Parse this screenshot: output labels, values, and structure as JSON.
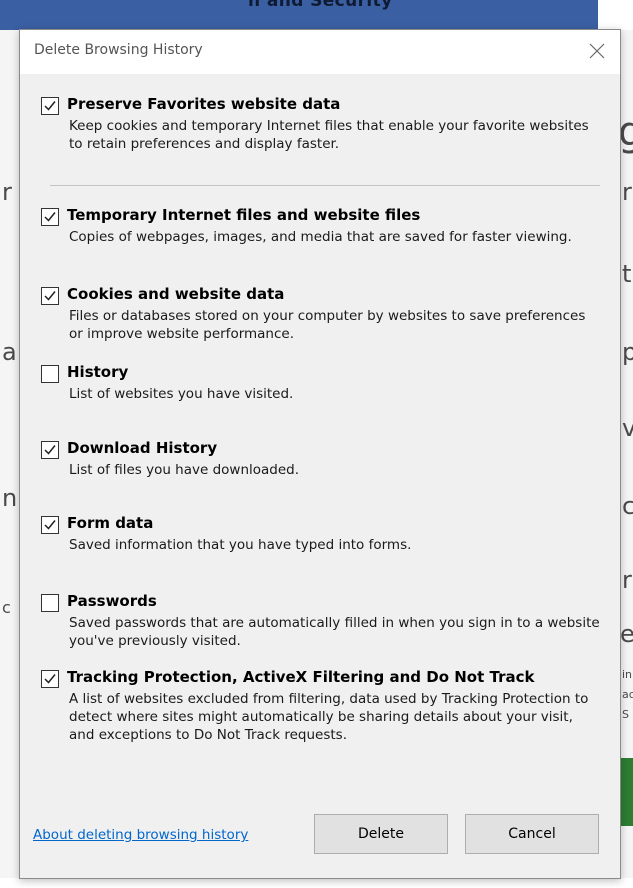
{
  "background": {
    "top_text": "n and Security",
    "fragments": [
      "g",
      "r",
      "t",
      "p",
      "a",
      "v",
      "n",
      "c",
      "r",
      "c",
      "e",
      "in",
      "ac",
      "S"
    ]
  },
  "dialog": {
    "title": "Delete Browsing History",
    "options": [
      {
        "label": "Preserve Favorites website data",
        "description": "Keep cookies and temporary Internet files that enable your favorite websites to retain preferences and display faster.",
        "checked": true
      },
      {
        "label": "Temporary Internet files and website files",
        "description": "Copies of webpages, images, and media that are saved for faster viewing.",
        "checked": true
      },
      {
        "label": "Cookies and website data",
        "description": "Files or databases stored on your computer by websites to save preferences or improve website performance.",
        "checked": true
      },
      {
        "label": "History",
        "description": "List of websites you have visited.",
        "checked": false
      },
      {
        "label": "Download History",
        "description": "List of files you have downloaded.",
        "checked": true
      },
      {
        "label": "Form data",
        "description": "Saved information that you have typed into forms.",
        "checked": true
      },
      {
        "label": "Passwords",
        "description": "Saved passwords that are automatically filled in when you sign in to a website you've previously visited.",
        "checked": false
      },
      {
        "label": "Tracking Protection, ActiveX Filtering and Do Not Track",
        "description": "A list of websites excluded from filtering, data used by Tracking Protection to detect where sites might automatically be sharing details about your visit, and exceptions to Do Not Track requests.",
        "checked": true
      }
    ],
    "about_link": "About deleting browsing history",
    "delete_label": "Delete",
    "cancel_label": "Cancel"
  }
}
